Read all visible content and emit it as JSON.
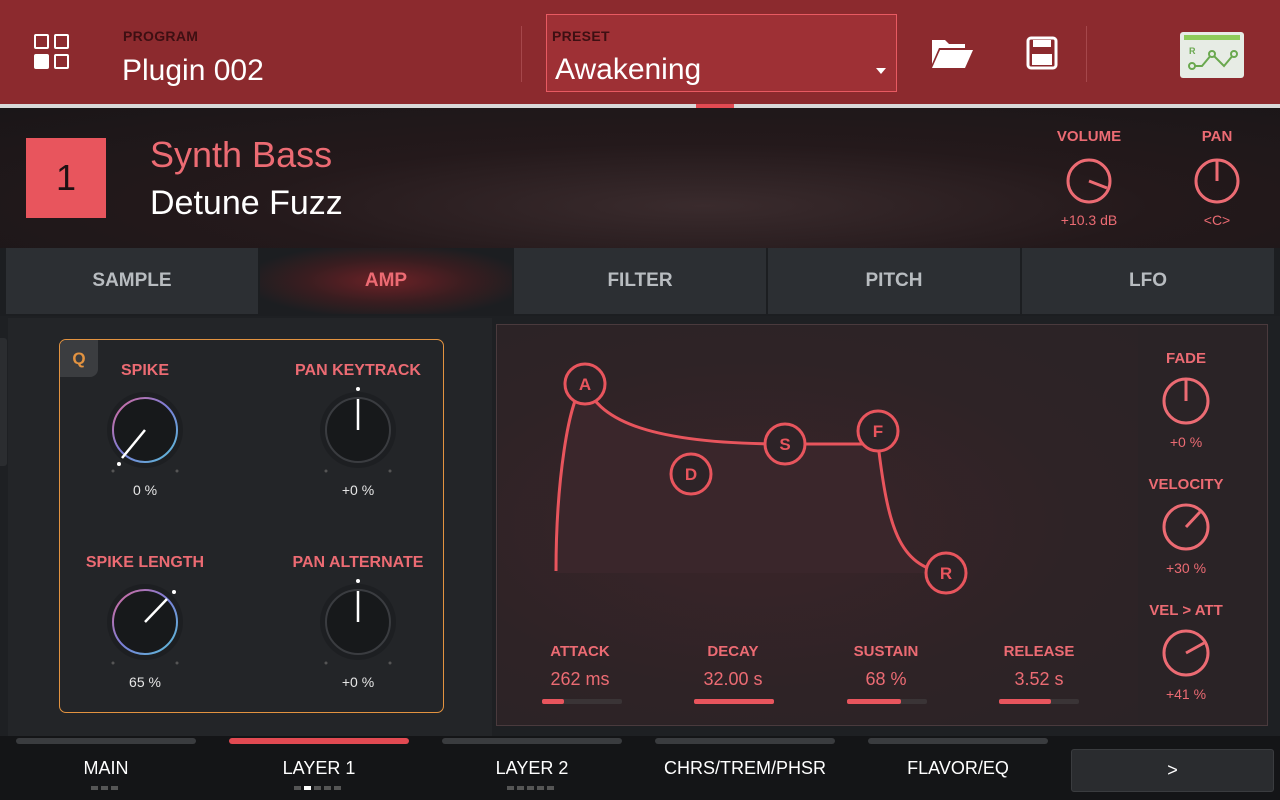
{
  "header": {
    "program_label": "PROGRAM",
    "program_name": "Plugin 002",
    "preset_label": "PRESET",
    "preset_name": "Awakening"
  },
  "layer": {
    "number": "1",
    "category": "Synth Bass",
    "name": "Detune Fuzz",
    "volume_label": "VOLUME",
    "volume_value": "+10.3 dB",
    "pan_label": "PAN",
    "pan_value": "<C>"
  },
  "tabs": [
    {
      "label": "SAMPLE",
      "active": false
    },
    {
      "label": "AMP",
      "active": true
    },
    {
      "label": "FILTER",
      "active": false
    },
    {
      "label": "PITCH",
      "active": false
    },
    {
      "label": "LFO",
      "active": false
    }
  ],
  "q_panel": {
    "badge": "Q",
    "knobs": [
      {
        "label": "SPIKE",
        "value": "0 %"
      },
      {
        "label": "PAN KEYTRACK",
        "value": "+0 %"
      },
      {
        "label": "SPIKE LENGTH",
        "value": "65 %"
      },
      {
        "label": "PAN ALTERNATE",
        "value": "+0 %"
      }
    ]
  },
  "envelope": {
    "nodes": [
      "A",
      "D",
      "S",
      "F",
      "R"
    ],
    "params": [
      {
        "label": "ATTACK",
        "value": "262 ms",
        "level": 0.27
      },
      {
        "label": "DECAY",
        "value": "32.00 s",
        "level": 1.0
      },
      {
        "label": "SUSTAIN",
        "value": "68 %",
        "level": 0.68
      },
      {
        "label": "RELEASE",
        "value": "3.52 s",
        "level": 0.65
      }
    ],
    "side_knobs": [
      {
        "label": "FADE",
        "value": "+0 %"
      },
      {
        "label": "VELOCITY",
        "value": "+30 %"
      },
      {
        "label": "VEL > ATT",
        "value": "+41 %"
      }
    ]
  },
  "bottom_nav": [
    {
      "label": "MAIN",
      "active": false
    },
    {
      "label": "LAYER 1",
      "active": true
    },
    {
      "label": "LAYER 2",
      "active": false
    },
    {
      "label": "CHRS/TREM/PHSR",
      "active": false
    },
    {
      "label": "FLAVOR/EQ",
      "active": false
    }
  ],
  "next_label": ">",
  "colors": {
    "accent": "#e8555d",
    "header_bg": "#8c2a2e",
    "q_border": "#e39340",
    "auto_bar": "#8dcc5a"
  }
}
